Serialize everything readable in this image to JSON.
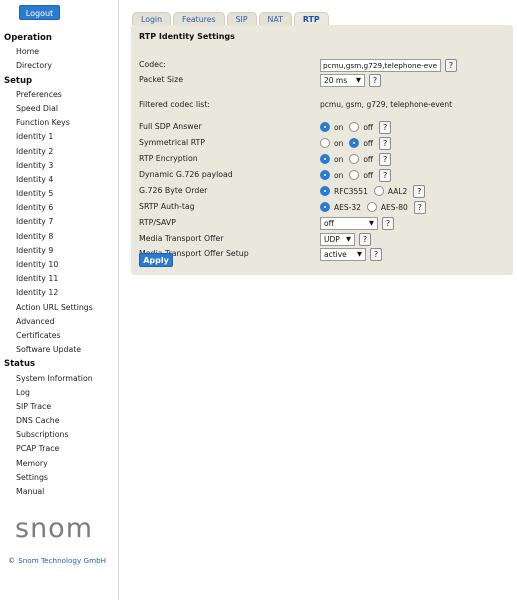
{
  "sidebar": {
    "logout_label": "Logout",
    "sections": [
      {
        "title": "Operation",
        "items": [
          "Home",
          "Directory"
        ]
      },
      {
        "title": "Setup",
        "items": [
          "Preferences",
          "Speed Dial",
          "Function Keys",
          "Identity 1",
          "Identity 2",
          "Identity 3",
          "Identity 4",
          "Identity 5",
          "Identity 6",
          "Identity 7",
          "Identity 8",
          "Identity 9",
          "Identity 10",
          "Identity 11",
          "Identity 12",
          "Action URL Settings",
          "Advanced",
          "Certificates",
          "Software Update"
        ]
      },
      {
        "title": "Status",
        "items": [
          "System Information",
          "Log",
          "SIP Trace",
          "DNS Cache",
          "Subscriptions",
          "PCAP Trace",
          "Memory",
          "Settings",
          "Manual"
        ]
      }
    ],
    "brand": "snom",
    "copyright_symbol": "©",
    "copyright_text": "Snom Technology GmbH"
  },
  "tabs": [
    {
      "label": "Login",
      "active": false
    },
    {
      "label": "Features",
      "active": false
    },
    {
      "label": "SIP",
      "active": false
    },
    {
      "label": "NAT",
      "active": false
    },
    {
      "label": "RTP",
      "active": true
    }
  ],
  "panel": {
    "title": "RTP Identity Settings",
    "apply_label": "Apply",
    "help_glyph": "?",
    "rows": [
      {
        "label": "Codec:",
        "type": "text",
        "value": "pcmu,gsm,g729,telephone-eve",
        "help": true
      },
      {
        "label": "Packet Size",
        "type": "select",
        "value": "20 ms",
        "help": true
      },
      {
        "label": "Filtered codec list:",
        "type": "plain",
        "value": "pcmu, gsm, g729, telephone-event",
        "help": false
      },
      {
        "label": "Full SDP Answer",
        "type": "radio",
        "options": [
          "on",
          "off"
        ],
        "selected": "on"
      },
      {
        "label": "Symmetrical RTP",
        "type": "radio",
        "options": [
          "on",
          "off"
        ],
        "selected": "off"
      },
      {
        "label": "RTP Encryption",
        "type": "radio",
        "options": [
          "on",
          "off"
        ],
        "selected": "on"
      },
      {
        "label": "Dynamic G.726 payload",
        "type": "radio",
        "options": [
          "on",
          "off"
        ],
        "selected": "on"
      },
      {
        "label": "G.726 Byte Order",
        "type": "radio",
        "options": [
          "RFC3551",
          "AAL2"
        ],
        "selected": "RFC3551"
      },
      {
        "label": "SRTP Auth-tag",
        "type": "radio",
        "options": [
          "AES-32",
          "AES-80"
        ],
        "selected": "AES-32"
      },
      {
        "label": "RTP/SAVP",
        "type": "select",
        "value": "off",
        "help": true
      },
      {
        "label": "Media Transport Offer",
        "type": "select",
        "value": "UDP",
        "help": true
      },
      {
        "label": "Media Transport Offer Setup",
        "type": "select",
        "value": "active",
        "help": true
      }
    ]
  },
  "colors": {
    "accent": "#2b7bd1",
    "panel_bg": "#eae8dc",
    "tab_text": "#2a5bb3"
  }
}
